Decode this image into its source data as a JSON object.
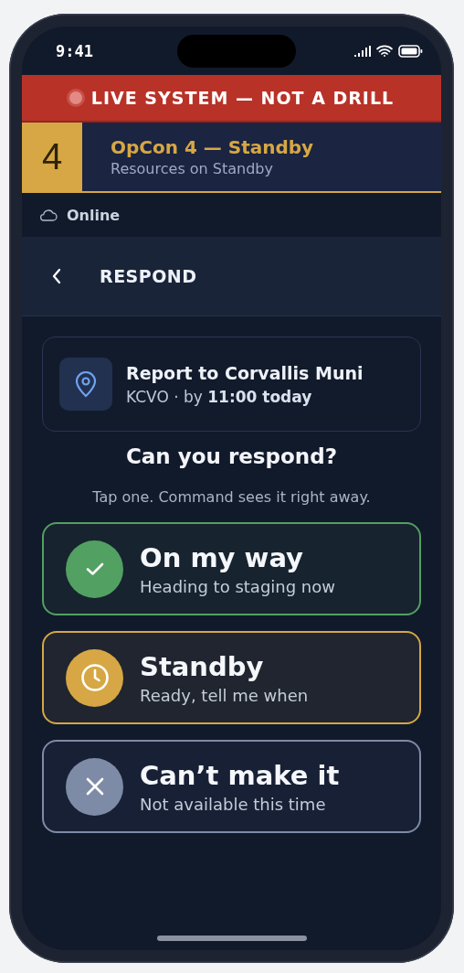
{
  "status_bar": {
    "time": "9:41"
  },
  "alert_banner": {
    "text": "LIVE SYSTEM — NOT A DRILL"
  },
  "opcon": {
    "level_number": "4",
    "title": "OpCon 4 — Standby",
    "subtitle": "Resources on Standby"
  },
  "connection": {
    "label": "Online"
  },
  "header": {
    "title": "RESPOND"
  },
  "assignment": {
    "title": "Report to Corvallis Muni",
    "detail": "KCVO · by **11:00 today**"
  },
  "prompt": {
    "title": "Can you respond?",
    "hint": "Tap one. Command sees it right away."
  },
  "options": [
    {
      "kind": "yes",
      "title": "On my way",
      "subtitle": "Heading to staging now",
      "color": "#52a062"
    },
    {
      "kind": "standby",
      "title": "Standby",
      "subtitle": "Ready, tell me when",
      "color": "#d6a744"
    },
    {
      "kind": "no",
      "title": "Can’t make it",
      "subtitle": "Not available this time",
      "color": "#7e8ba6"
    }
  ]
}
